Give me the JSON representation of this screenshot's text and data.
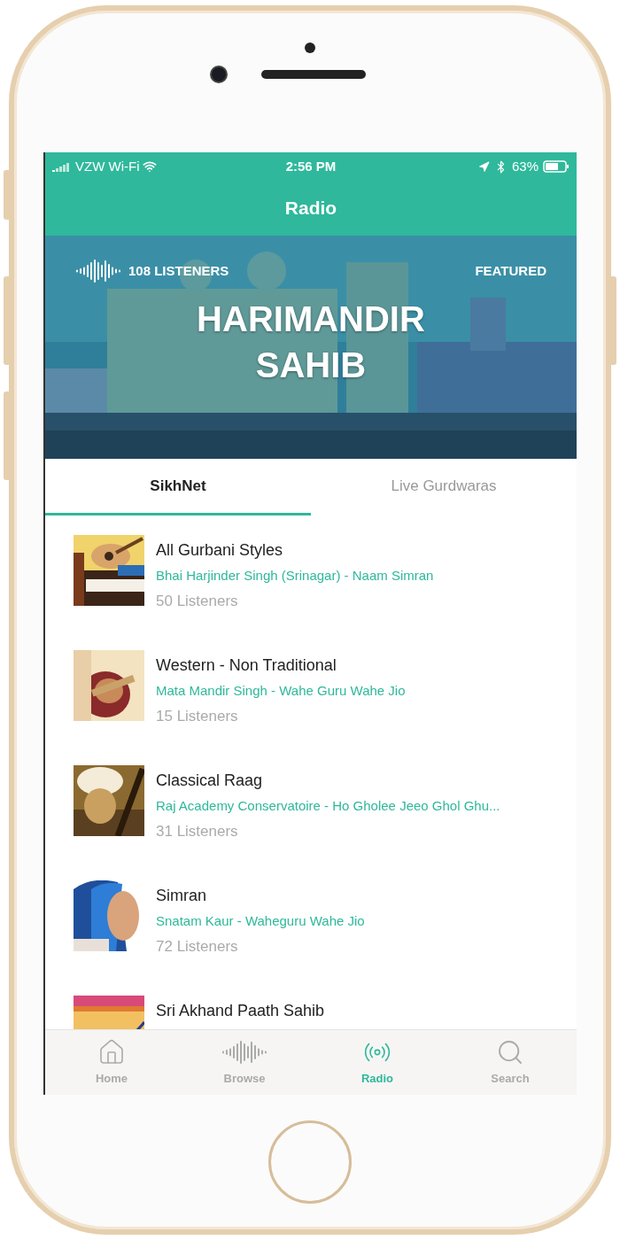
{
  "status_bar": {
    "carrier": "VZW Wi-Fi",
    "time": "2:56 PM",
    "battery": "63%"
  },
  "nav": {
    "title": "Radio"
  },
  "featured": {
    "listeners": "108 LISTENERS",
    "badge": "FEATURED",
    "title": "HARIMANDIR SAHIB"
  },
  "tabs": [
    {
      "label": "SikhNet",
      "selected": true
    },
    {
      "label": "Live Gurdwaras",
      "selected": false
    }
  ],
  "stations": [
    {
      "title": "All Gurbani Styles",
      "subtitle": "Bhai Harjinder Singh (Srinagar) - Naam Simran",
      "listeners": "50 Listeners"
    },
    {
      "title": "Western - Non Traditional",
      "subtitle": "Mata Mandir Singh - Wahe Guru Wahe Jio",
      "listeners": "15 Listeners"
    },
    {
      "title": "Classical Raag",
      "subtitle": "Raj Academy Conservatoire - Ho Gholee Jeeo Ghol Ghu...",
      "listeners": "31 Listeners"
    },
    {
      "title": "Simran",
      "subtitle": "Snatam Kaur - Waheguru Wahe Jio",
      "listeners": "72 Listeners"
    },
    {
      "title": "Sri Akhand Paath Sahib"
    }
  ],
  "tab_bar": [
    {
      "label": "Home",
      "kind": "home",
      "selected": false
    },
    {
      "label": "Browse",
      "kind": "browse",
      "selected": false
    },
    {
      "label": "Radio",
      "kind": "radio",
      "selected": true
    },
    {
      "label": "Search",
      "kind": "search",
      "selected": false
    }
  ]
}
